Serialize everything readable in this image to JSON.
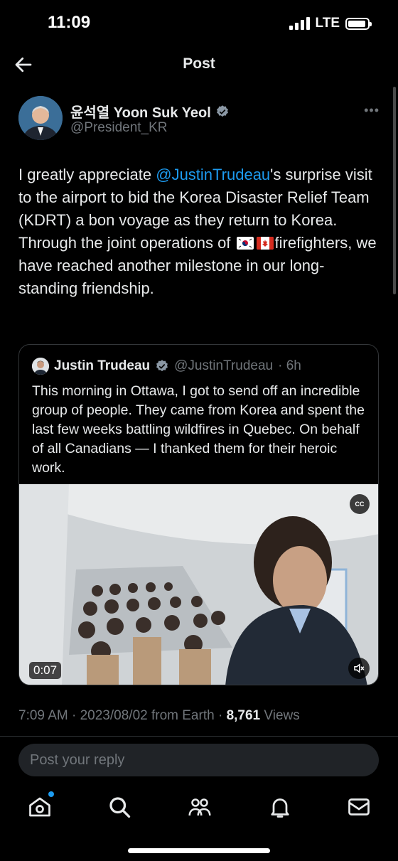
{
  "status_bar": {
    "time": "11:09",
    "network": "LTE"
  },
  "header": {
    "title": "Post"
  },
  "author": {
    "name": "윤석열 Yoon Suk Yeol",
    "handle": "@President_KR"
  },
  "tweet": {
    "text_1a": "I greatly appreciate ",
    "mention": "@JustinTrudeau",
    "text_1b": "'s surprise visit to the airport to bid the Korea Disaster Relief Team (KDRT) a bon voyage as they return to Korea.",
    "text_2a": "Through the joint operations of ",
    "text_2b": "firefighters, we have reached another milestone in our long-standing friendship."
  },
  "quote": {
    "name": "Justin Trudeau",
    "handle": "@JustinTrudeau",
    "time": "· 6h",
    "text": "This morning in Ottawa, I got to send off an incredible group of people. They came from Korea and spent the last few weeks battling wildfires in Quebec. On behalf of all Canadians — I thanked them for their heroic work.",
    "video_duration": "0:07",
    "cc_label": "CC"
  },
  "meta": {
    "time": "7:09 AM",
    "date": "· 2023/08/02 from Earth ·",
    "views_count": "8,761",
    "views_label": "Views"
  },
  "reply": {
    "placeholder": "Post your reply"
  },
  "colors": {
    "accent": "#1d9bf0",
    "background": "#000000",
    "muted": "#71767b"
  }
}
